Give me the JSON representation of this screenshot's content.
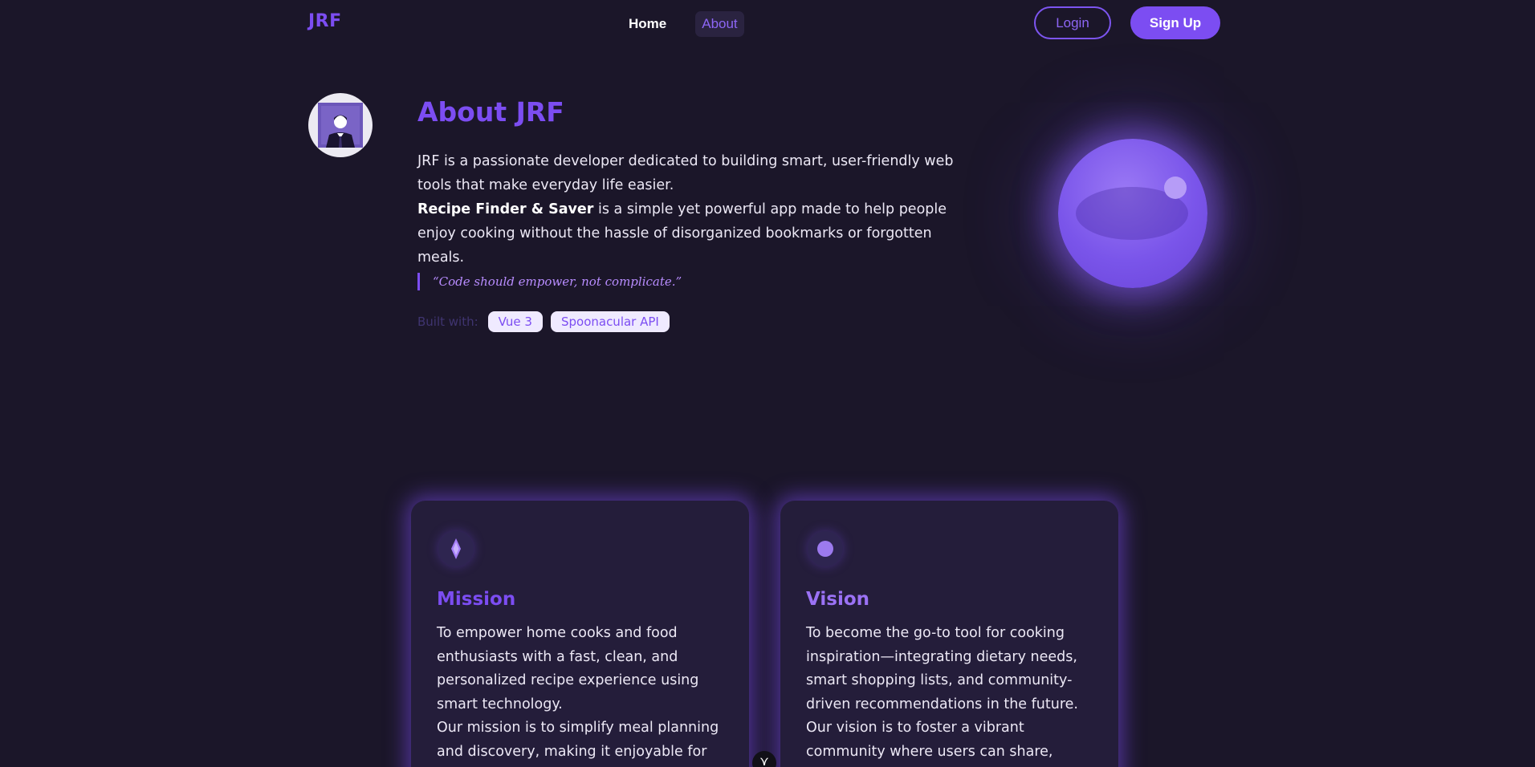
{
  "header": {
    "logo": "JRF",
    "nav": [
      {
        "label": "Home"
      },
      {
        "label": "About"
      }
    ],
    "login_label": "Login",
    "signup_label": "Sign Up"
  },
  "about": {
    "title": "About JRF",
    "intro": "JRF is a passionate developer dedicated to building smart, user-friendly web tools that make everyday life easier.",
    "app_name": "Recipe Finder & Saver",
    "app_desc": " is a simple yet powerful app made to help people enjoy cooking without the hassle of disorganized bookmarks or forgotten meals.",
    "quote": "“Code should empower, not complicate.”",
    "built_with_label": "Built with:",
    "tech": [
      "Vue 3",
      "Spoonacular API"
    ]
  },
  "cards": {
    "mission": {
      "icon": "diamond-icon",
      "title": "Mission",
      "text1": "To empower home cooks and food enthusiasts with a fast, clean, and personalized recipe experience using smart technology.",
      "text2": "Our mission is to simplify meal planning and discovery, making it enjoyable for everyone—"
    },
    "vision": {
      "icon": "dot-icon",
      "title": "Vision",
      "text1": "To become the go-to tool for cooking inspiration—integrating dietary needs, smart shopping lists, and community-driven recommendations in the future.",
      "text2": "Our vision is to foster a vibrant community where users can share, discover, and adapt"
    }
  },
  "scroll_button_glyph": "⋎",
  "colors": {
    "background": "#1b1629",
    "accent": "#7c4df2",
    "card": "#241d3a",
    "quote": "#b88cff"
  }
}
